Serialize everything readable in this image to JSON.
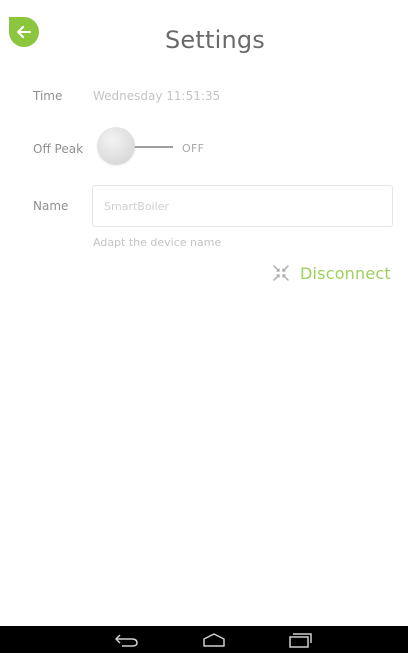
{
  "header": {
    "title": "Settings",
    "back_icon": "back-arrow-icon"
  },
  "settings": {
    "time": {
      "label": "Time",
      "value": "Wednesday 11:51:35"
    },
    "off_peak": {
      "label": "Off Peak",
      "state": "OFF",
      "enabled": false
    },
    "name": {
      "label": "Name",
      "placeholder": "SmartBoiler",
      "value": "",
      "hint": "Adapt the device name"
    }
  },
  "disconnect": {
    "label": "Disconnect",
    "icon": "disconnect-icon"
  },
  "navbar": {
    "back_icon": "nav-back-icon",
    "home_icon": "nav-home-icon",
    "recent_icon": "nav-recent-apps-icon"
  },
  "colors": {
    "accent": "#8cc63f",
    "accent_text": "#9ed05a",
    "navbar": "#000000"
  }
}
